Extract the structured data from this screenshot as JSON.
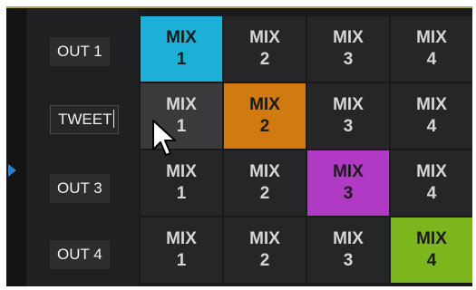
{
  "rows": [
    {
      "label": "OUT 1",
      "cells": [
        {
          "title": "MIX",
          "num": "1"
        },
        {
          "title": "MIX",
          "num": "2"
        },
        {
          "title": "MIX",
          "num": "3"
        },
        {
          "title": "MIX",
          "num": "4"
        }
      ],
      "active_index": 0,
      "active_color": "#1cb0d8"
    },
    {
      "label": "TWEET",
      "cells": [
        {
          "title": "MIX",
          "num": "1"
        },
        {
          "title": "MIX",
          "num": "2"
        },
        {
          "title": "MIX",
          "num": "3"
        },
        {
          "title": "MIX",
          "num": "4"
        }
      ],
      "active_index": 1,
      "active_color": "#d07a10"
    },
    {
      "label": "OUT 3",
      "cells": [
        {
          "title": "MIX",
          "num": "1"
        },
        {
          "title": "MIX",
          "num": "2"
        },
        {
          "title": "MIX",
          "num": "3"
        },
        {
          "title": "MIX",
          "num": "4"
        }
      ],
      "active_index": 2,
      "active_color": "#b13ac4"
    },
    {
      "label": "OUT 4",
      "cells": [
        {
          "title": "MIX",
          "num": "1"
        },
        {
          "title": "MIX",
          "num": "2"
        },
        {
          "title": "MIX",
          "num": "3"
        },
        {
          "title": "MIX",
          "num": "4"
        }
      ],
      "active_index": 3,
      "active_color": "#7db51c"
    }
  ],
  "colors": {
    "panel_bg": "#1a1a1b",
    "cell_bg": "#262628",
    "accent_arrow": "#2a7fd4",
    "top_border": "#b5a65a"
  },
  "icons": {
    "side_arrow": "triangle-right-icon",
    "pointer": "mouse-pointer-icon"
  }
}
